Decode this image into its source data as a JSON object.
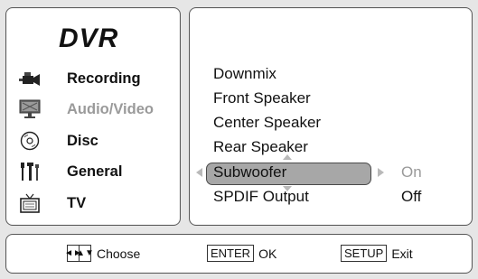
{
  "app": {
    "title": "DVR"
  },
  "sidebar": {
    "items": [
      {
        "label": "Recording",
        "icon": "camcorder-icon",
        "state": "active"
      },
      {
        "label": "Audio/Video",
        "icon": "monitor-icon",
        "state": "selected"
      },
      {
        "label": "Disc",
        "icon": "disc-icon",
        "state": "active"
      },
      {
        "label": "General",
        "icon": "tools-icon",
        "state": "active"
      },
      {
        "label": "TV",
        "icon": "tv-icon",
        "state": "active"
      }
    ]
  },
  "menu": {
    "items": [
      {
        "label": "Downmix"
      },
      {
        "label": "Front Speaker"
      },
      {
        "label": "Center Speaker"
      },
      {
        "label": "Rear Speaker"
      },
      {
        "label": "Subwoofer",
        "selected": true
      },
      {
        "label": "SPDIF Output"
      }
    ],
    "options": [
      {
        "label": "On",
        "state": "inactive"
      },
      {
        "label": "Off",
        "state": "active"
      }
    ]
  },
  "footer": {
    "choose_label": "Choose",
    "choose_keys": [
      "◄►",
      "▲▼"
    ],
    "enter_key": "ENTER",
    "enter_label": "OK",
    "setup_key": "SETUP",
    "setup_label": "Exit"
  },
  "colors": {
    "background": "#e6e6e6",
    "panel": "#ffffff",
    "highlight": "#a7a7a7",
    "dim_text": "#9a9a9a"
  }
}
